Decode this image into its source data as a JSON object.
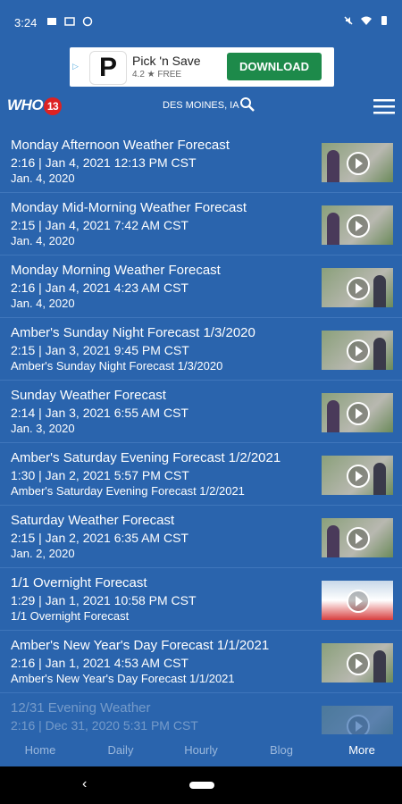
{
  "status": {
    "time": "3:24"
  },
  "ad": {
    "name": "Pick 'n Save",
    "rating": "4.2 ★  FREE",
    "button": "DOWNLOAD",
    "logo_letter": "P"
  },
  "header": {
    "brand": "WHO",
    "brand_num": "13",
    "location": "DES MOINES, IA"
  },
  "items": [
    {
      "title": "Monday Afternoon Weather Forecast",
      "meta": "2:16 | Jan 4, 2021 12:13 PM CST",
      "sub": "Jan. 4, 2020"
    },
    {
      "title": "Monday Mid-Morning Weather Forecast",
      "meta": "2:15 | Jan 4, 2021 7:42 AM CST",
      "sub": "Jan. 4, 2020"
    },
    {
      "title": "Monday Morning Weather Forecast",
      "meta": "2:16 | Jan 4, 2021 4:23 AM CST",
      "sub": "Jan. 4, 2020"
    },
    {
      "title": "Amber's Sunday Night Forecast 1/3/2020",
      "meta": "2:15 | Jan 3, 2021 9:45 PM CST",
      "sub": "Amber's Sunday Night Forecast 1/3/2020"
    },
    {
      "title": "Sunday Weather Forecast",
      "meta": "2:14 | Jan 3, 2021 6:55 AM CST",
      "sub": "Jan. 3, 2020"
    },
    {
      "title": "Amber's Saturday Evening Forecast 1/2/2021",
      "meta": "1:30 | Jan 2, 2021 5:57 PM CST",
      "sub": "Amber's Saturday Evening Forecast 1/2/2021"
    },
    {
      "title": "Saturday Weather Forecast",
      "meta": "2:15 | Jan 2, 2021 6:35 AM CST",
      "sub": "Jan. 2, 2020"
    },
    {
      "title": "1/1 Overnight Forecast",
      "meta": "1:29 | Jan 1, 2021 10:58 PM CST",
      "sub": "1/1 Overnight Forecast"
    },
    {
      "title": "Amber's New Year's Day Forecast 1/1/2021",
      "meta": "2:16 | Jan 1, 2021 4:53 AM CST",
      "sub": "Amber's New Year's Day Forecast 1/1/2021"
    },
    {
      "title": "12/31 Evening Weather",
      "meta": "2:16 | Dec 31, 2020 5:31 PM CST",
      "sub": ""
    }
  ],
  "tabs": [
    "Home",
    "Daily",
    "Hourly",
    "Blog",
    "More"
  ],
  "colors": {
    "header_bg": "#2a64ad",
    "tab_active": "#ffffff",
    "tab_inactive": "#9bb8dc",
    "ad_button": "#1d8a4a"
  }
}
